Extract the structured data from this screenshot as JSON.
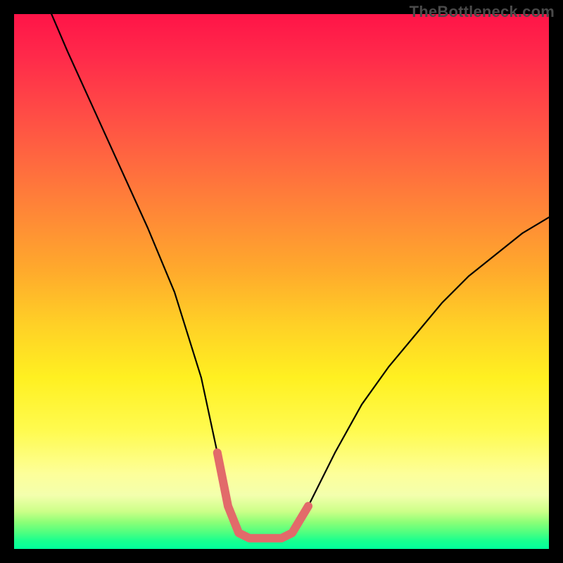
{
  "watermark": "TheBottleneck.com",
  "chart_data": {
    "type": "line",
    "title": "",
    "xlabel": "",
    "ylabel": "",
    "xlim": [
      0,
      100
    ],
    "ylim": [
      0,
      100
    ],
    "grid": false,
    "legend": false,
    "series": [
      {
        "name": "bottleneck-curve",
        "x": [
          7,
          10,
          15,
          20,
          25,
          30,
          35,
          38,
          40,
          42,
          44,
          46,
          48,
          50,
          52,
          55,
          60,
          65,
          70,
          75,
          80,
          85,
          90,
          95,
          100
        ],
        "y": [
          100,
          93,
          82,
          71,
          60,
          48,
          32,
          18,
          8,
          3,
          2,
          2,
          2,
          2,
          3,
          8,
          18,
          27,
          34,
          40,
          46,
          51,
          55,
          59,
          62
        ]
      },
      {
        "name": "flat-bottom-highlight",
        "x": [
          38,
          40,
          42,
          44,
          46,
          48,
          50,
          52,
          55
        ],
        "y": [
          18,
          8,
          3,
          2,
          2,
          2,
          2,
          3,
          8
        ]
      }
    ],
    "colors": {
      "curve": "#000000",
      "highlight": "#e26a6a",
      "gradient_top": "#ff1448",
      "gradient_bottom": "#00ff9c"
    },
    "annotations": []
  }
}
